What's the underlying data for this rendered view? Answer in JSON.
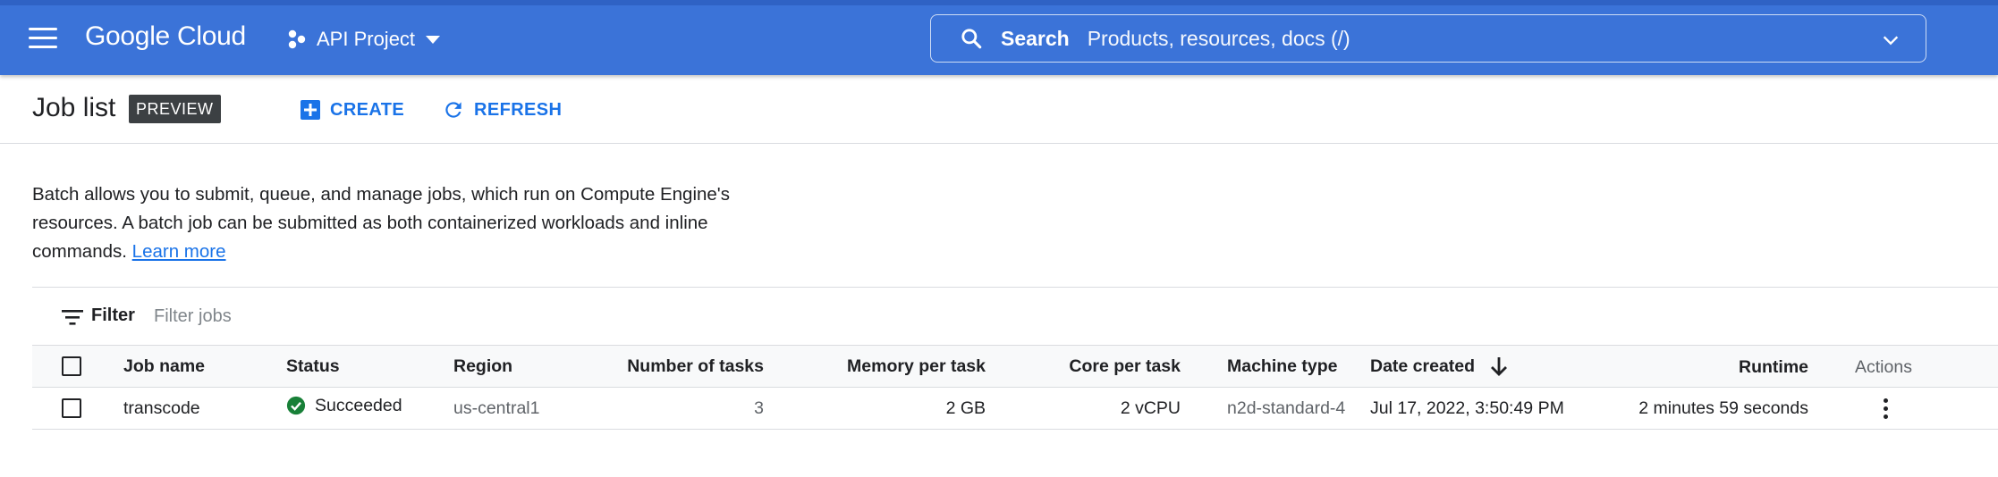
{
  "header": {
    "app_name": "Google Cloud",
    "project": "API Project",
    "search_label": "Search",
    "search_placeholder": "Products, resources, docs (/)"
  },
  "page": {
    "title": "Job list",
    "badge": "PREVIEW",
    "create_label": "CREATE",
    "refresh_label": "REFRESH",
    "description": "Batch allows you to submit, queue, and manage jobs, which run on Compute Engine's resources. A batch job can be submitted as both containerized workloads and inline commands.",
    "learn_more": "Learn more"
  },
  "filter": {
    "label": "Filter",
    "placeholder": "Filter jobs"
  },
  "table": {
    "columns": {
      "job_name": "Job name",
      "status": "Status",
      "region": "Region",
      "tasks": "Number of tasks",
      "memory": "Memory per task",
      "cores": "Core per task",
      "machine": "Machine type",
      "date": "Date created",
      "runtime": "Runtime",
      "actions": "Actions"
    },
    "rows": [
      {
        "job_name": "transcode",
        "status": "Succeeded",
        "region": "us-central1",
        "tasks": "3",
        "memory": "2 GB",
        "cores": "2 vCPU",
        "machine": "n2d-standard-4",
        "date": "Jul 17, 2022, 3:50:49 PM",
        "runtime": "2 minutes 59 seconds"
      }
    ]
  },
  "colors": {
    "header_bg": "#3b73d8",
    "accent": "#1a73e8",
    "success": "#188038"
  },
  "icons": [
    "menu-icon",
    "project-icon",
    "search-icon",
    "chevron-down-icon",
    "add-box-icon",
    "refresh-icon",
    "filter-icon",
    "check-circle-icon",
    "arrow-downward-icon",
    "more-vert-icon"
  ]
}
